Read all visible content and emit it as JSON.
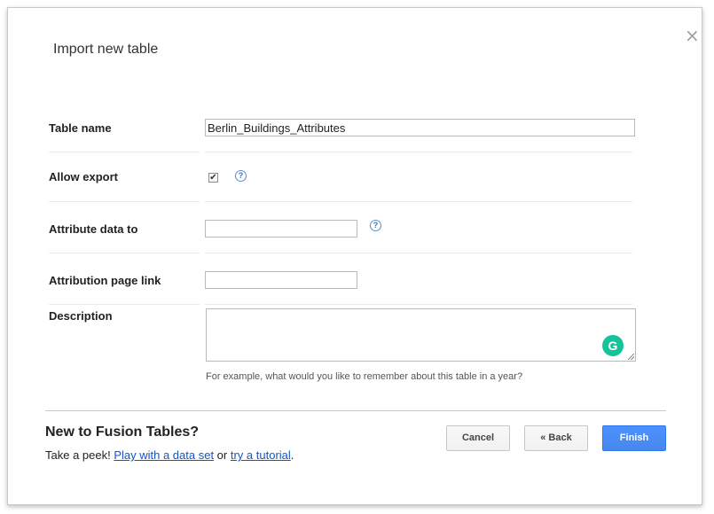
{
  "dialog": {
    "title": "Import new table",
    "close_glyph": "×"
  },
  "form": {
    "table_name": {
      "label": "Table name",
      "value": "Berlin_Buildings_Attributes"
    },
    "allow_export": {
      "label": "Allow export",
      "checked": true,
      "help_glyph": "?"
    },
    "attribute_data_to": {
      "label": "Attribute data to",
      "value": "",
      "help_glyph": "?"
    },
    "attribution_page_link": {
      "label": "Attribution page link",
      "value": ""
    },
    "description": {
      "label": "Description",
      "value": "",
      "hint": "For example, what would you like to remember about this table in a year?",
      "grammarly_glyph": "G"
    }
  },
  "footer": {
    "heading": "New to Fusion Tables?",
    "peek_prefix": "Take a peek! ",
    "link_dataset": "Play with a data set",
    "between": " or ",
    "link_tutorial": "try a tutorial",
    "suffix": ".",
    "cancel_label": "Cancel",
    "back_label": "« Back",
    "finish_label": "Finish"
  },
  "colors": {
    "accent": "#4d90fe",
    "link": "#1155cc",
    "grammarly": "#15c39a"
  }
}
